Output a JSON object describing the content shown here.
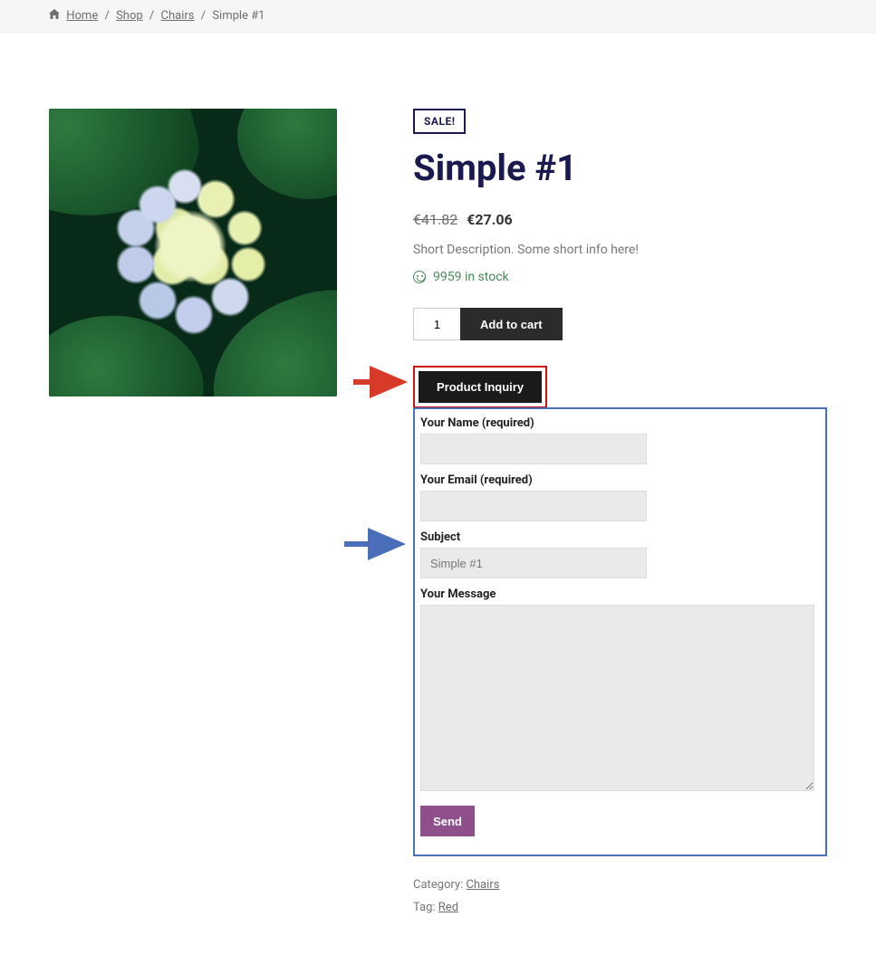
{
  "breadcrumb": {
    "home": "Home",
    "shop": "Shop",
    "chairs": "Chairs",
    "current": "Simple #1",
    "separator": "/"
  },
  "badge": "SALE!",
  "product_title": "Simple #1",
  "price": {
    "old": "€41.82",
    "new": "€27.06"
  },
  "short_description": "Short Description. Some short info here!",
  "stock_text": "9959 in stock",
  "qty_value": "1",
  "add_to_cart_label": "Add to cart",
  "inquiry_tab_label": "Product Inquiry",
  "form": {
    "name_label": "Your Name (required)",
    "email_label": "Your Email (required)",
    "subject_label": "Subject",
    "subject_value": "Simple #1",
    "message_label": "Your Message",
    "send_label": "Send"
  },
  "meta": {
    "category_label": "Category: ",
    "category_value": "Chairs",
    "tag_label": "Tag: ",
    "tag_value": "Red"
  }
}
